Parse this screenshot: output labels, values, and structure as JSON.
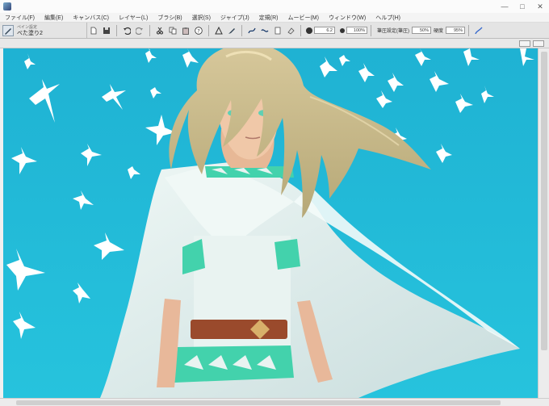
{
  "titlebar": {
    "minimize": "—",
    "maximize": "□",
    "close": "✕"
  },
  "menu": [
    "ファイル(F)",
    "編集(E)",
    "キャンバス(C)",
    "レイヤー(L)",
    "ブラシ(B)",
    "選択(S)",
    "ジャイプ(J)",
    "定規(R)",
    "ムービー(M)",
    "ウィンドウ(W)",
    "ヘルプ(H)"
  ],
  "brush": {
    "category": "ペイン設定",
    "name": "べた塗り2"
  },
  "toolbar": {
    "size_value": "6.2",
    "opacity_value": "100%",
    "stabilizer_label": "筆圧設定(筆圧)",
    "stabilizer_value": "50%",
    "density_label": "硬度",
    "density_value": "95%"
  },
  "icons": {
    "brush": "brush-icon",
    "new": "new-file-icon",
    "save": "save-icon",
    "undo": "undo-icon",
    "redo": "redo-icon",
    "cut": "cut-icon",
    "copy": "copy-icon",
    "paste": "paste-icon",
    "help": "help-icon"
  },
  "colors": {
    "sky": "#1fb6d5",
    "cloak": "#dfeeee",
    "hair": "#c9b98a",
    "belt": "#9a4a2c",
    "trim": "#43d2ac"
  }
}
